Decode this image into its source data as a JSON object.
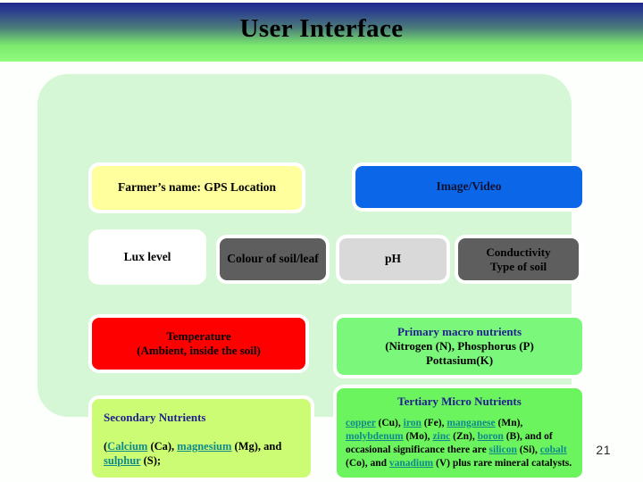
{
  "header": {
    "title": "User Interface"
  },
  "panel": {
    "boxes": [
      {
        "id": "farmer",
        "label": "Farmer’s name: GPS Location",
        "color": "#ffff9e"
      },
      {
        "id": "image_video",
        "label": "Image/Video",
        "color": "#0c66e8"
      },
      {
        "id": "lux",
        "label": "Lux level",
        "color": "#ffffff"
      },
      {
        "id": "colour",
        "label": "Colour of soil/leaf",
        "color": "#5e5e5e"
      },
      {
        "id": "ph",
        "label": "pH",
        "color": "#d9d9d9"
      },
      {
        "id": "conductivity",
        "line1": "Conductivity",
        "line2": "Type of soil",
        "color": "#5e5e5e"
      },
      {
        "id": "temperature",
        "line1": "Temperature",
        "line2": "(Ambient, inside the soil)",
        "color": "#fe0000"
      },
      {
        "id": "primary",
        "line1": "Primary macro nutrients",
        "line2": "(Nitrogen (N), Phosphorus (P)",
        "line3": "Pottasium(K)",
        "color": "#7bf77b"
      }
    ]
  },
  "secondary_nutrients": {
    "title": "Secondary Nutrients",
    "open_paren": "(",
    "links": [
      {
        "text": "Calcium",
        "suffix": " (Ca), "
      },
      {
        "text": "magnesium",
        "suffix": " (Mg), and "
      },
      {
        "text": "sulphur",
        "suffix": " (S);"
      }
    ]
  },
  "tertiary_nutrients": {
    "title": "Tertiary Micro Nutrients",
    "segments": [
      {
        "link": "copper",
        "after": " (Cu), "
      },
      {
        "link": "iron",
        "after": " (Fe), "
      },
      {
        "link": "manganese",
        "after": " (Mn), "
      },
      {
        "link": "molybdenum",
        "after": " (Mo), "
      },
      {
        "link": "zinc",
        "after": " (Zn), "
      },
      {
        "link": "boron",
        "after": " (B), and of occasional significance there are "
      },
      {
        "link": "silicon",
        "after": " (Si), "
      },
      {
        "link": "cobalt",
        "after": " (Co), and "
      },
      {
        "link": "vanadium",
        "after": " (V) plus rare mineral catalysts."
      }
    ]
  },
  "footer": {
    "page_number": "21"
  },
  "colors": {
    "panel_background": "#d6f7d6",
    "link": "#0f8a8a",
    "heading_navy": "#1f1f8f",
    "banner_top": "#1f2a8c",
    "banner_bottom": "#93fc7e"
  }
}
